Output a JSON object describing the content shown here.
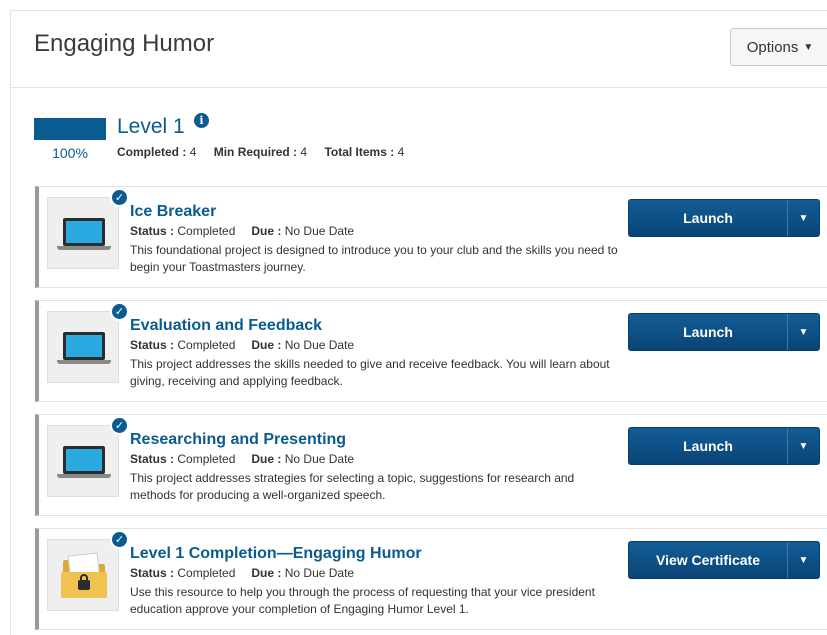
{
  "header": {
    "title": "Engaging Humor",
    "options_label": "Options",
    "options_caret": "▼"
  },
  "level": {
    "title": "Level 1",
    "info_glyph": "i",
    "progress_value": 100,
    "progress_label": "100%",
    "stats": [
      {
        "label": "Completed :",
        "value": "4"
      },
      {
        "label": "Min Required :",
        "value": "4"
      },
      {
        "label": "Total Items :",
        "value": "4"
      }
    ]
  },
  "status_label": "Status :",
  "due_label": "Due :",
  "check_glyph": "✓",
  "dropdown_glyph": "▼",
  "items": [
    {
      "title": "Ice Breaker",
      "icon": "laptop-icon",
      "status": "Completed",
      "due": "No Due Date",
      "description": "This foundational project is designed to introduce you to your club and the skills you need to begin your Toastmasters journey.",
      "action": "Launch"
    },
    {
      "title": "Evaluation and Feedback",
      "icon": "laptop-icon",
      "status": "Completed",
      "due": "No Due Date",
      "description": "This project addresses the skills needed to give and receive feedback. You will learn about giving, receiving and applying feedback.",
      "action": "Launch"
    },
    {
      "title": "Researching and Presenting",
      "icon": "laptop-icon",
      "status": "Completed",
      "due": "No Due Date",
      "description": "This project addresses strategies for selecting a topic, suggestions for research and methods for producing a well-organized speech.",
      "action": "Launch"
    },
    {
      "title": "Level 1 Completion—Engaging Humor",
      "icon": "folder-lock-icon",
      "status": "Completed",
      "due": "No Due Date",
      "description": "Use this resource to help you through the process of requesting that your vice president education approve your completion of Engaging Humor Level 1.",
      "action": "View Certificate"
    }
  ],
  "colors": {
    "accent": "#0a5b8f",
    "button": "#0e4f85"
  }
}
